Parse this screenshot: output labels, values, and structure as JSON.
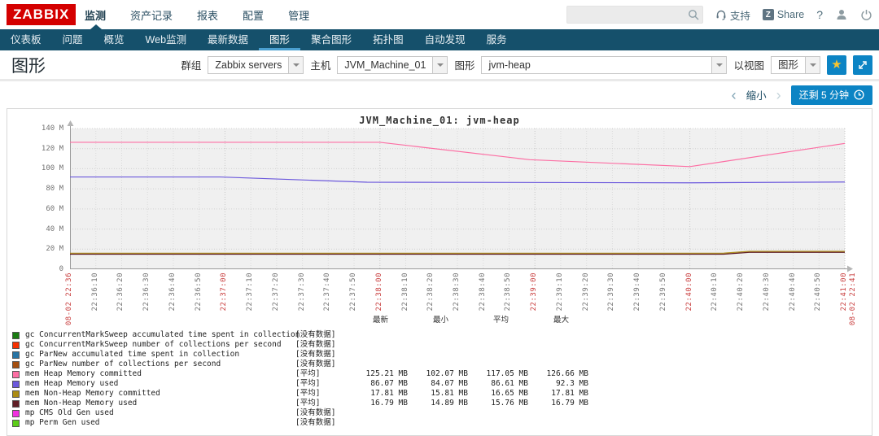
{
  "topbar": {
    "logo": "ZABBIX",
    "menu": [
      "监测",
      "资产记录",
      "报表",
      "配置",
      "管理"
    ],
    "active_menu": "监测",
    "search": {
      "value": "",
      "placeholder": ""
    },
    "support_label": "支持",
    "share_label": "Share",
    "share_icon_letter": "Z",
    "help_label": "?"
  },
  "subnav": {
    "items": [
      "仪表板",
      "问题",
      "概览",
      "Web监测",
      "最新数据",
      "图形",
      "聚合图形",
      "拓扑图",
      "自动发现",
      "服务"
    ],
    "active": "图形"
  },
  "page": {
    "title": "图形"
  },
  "filters": {
    "group_label": "群组",
    "group_value": "Zabbix servers",
    "host_label": "主机",
    "host_value": "JVM_Machine_01",
    "graph_label": "图形",
    "graph_value": "jvm-heap",
    "view_label": "以视图",
    "view_value": "图形"
  },
  "timebar": {
    "prev": "‹",
    "zoom_out": "缩小",
    "next": "›",
    "remaining_label": "还剩 5 分钟"
  },
  "chart_data": {
    "type": "line",
    "title": "JVM_Machine_01: jvm-heap",
    "ylabel_unit": "M",
    "ylim": [
      0,
      140
    ],
    "xlim_seconds": [
      0,
      300
    ],
    "x_start_time": "08-02 22:36",
    "x_end_time": "08-02 22:41",
    "plot_bg": "#f0f0f0",
    "yticks": [
      {
        "v": 0,
        "label": "0"
      },
      {
        "v": 20,
        "label": "20 M"
      },
      {
        "v": 40,
        "label": "40 M"
      },
      {
        "v": 60,
        "label": "60 M"
      },
      {
        "v": 80,
        "label": "80 M"
      },
      {
        "v": 100,
        "label": "100 M"
      },
      {
        "v": 120,
        "label": "120 M"
      },
      {
        "v": 140,
        "label": "140 M"
      }
    ],
    "xticks": [
      {
        "t": 0,
        "label": "08-02 22:36",
        "red": true
      },
      {
        "t": 10,
        "label": "22:36:10"
      },
      {
        "t": 20,
        "label": "22:36:20"
      },
      {
        "t": 30,
        "label": "22:36:30"
      },
      {
        "t": 40,
        "label": "22:36:40"
      },
      {
        "t": 50,
        "label": "22:36:50"
      },
      {
        "t": 60,
        "label": "22:37:00",
        "red": true
      },
      {
        "t": 70,
        "label": "22:37:10"
      },
      {
        "t": 80,
        "label": "22:37:20"
      },
      {
        "t": 90,
        "label": "22:37:30"
      },
      {
        "t": 100,
        "label": "22:37:40"
      },
      {
        "t": 110,
        "label": "22:37:50"
      },
      {
        "t": 120,
        "label": "22:38:00",
        "red": true
      },
      {
        "t": 130,
        "label": "22:38:10"
      },
      {
        "t": 140,
        "label": "22:38:20"
      },
      {
        "t": 150,
        "label": "22:38:30"
      },
      {
        "t": 160,
        "label": "22:38:40"
      },
      {
        "t": 170,
        "label": "22:38:50"
      },
      {
        "t": 180,
        "label": "22:39:00",
        "red": true
      },
      {
        "t": 190,
        "label": "22:39:10"
      },
      {
        "t": 200,
        "label": "22:39:20"
      },
      {
        "t": 210,
        "label": "22:39:30"
      },
      {
        "t": 220,
        "label": "22:39:40"
      },
      {
        "t": 230,
        "label": "22:39:50"
      },
      {
        "t": 240,
        "label": "22:40:00",
        "red": true
      },
      {
        "t": 250,
        "label": "22:40:10"
      },
      {
        "t": 260,
        "label": "22:40:20"
      },
      {
        "t": 270,
        "label": "22:40:30"
      },
      {
        "t": 280,
        "label": "22:40:40"
      },
      {
        "t": 290,
        "label": "22:40:50"
      },
      {
        "t": 300,
        "label": "22:41:00",
        "red": true
      },
      {
        "t": 300,
        "label": "08-02 22:41",
        "red": true,
        "offset": 11
      }
    ],
    "series": [
      {
        "name": "mem Heap Memory committed",
        "color": "#FC6EA3",
        "points": [
          [
            0,
            126.3
          ],
          [
            120,
            126.3
          ],
          [
            178,
            109.0
          ],
          [
            240,
            102.1
          ],
          [
            300,
            125.2
          ]
        ]
      },
      {
        "name": "mem Heap Memory used",
        "color": "#6C59DC",
        "points": [
          [
            0,
            91.8
          ],
          [
            58,
            91.8
          ],
          [
            115,
            86.6
          ],
          [
            240,
            86.0
          ],
          [
            300,
            86.8
          ]
        ]
      },
      {
        "name": "mem Non-Heap Memory committed",
        "color": "#AC8C14",
        "points": [
          [
            0,
            15.95
          ],
          [
            253,
            15.95
          ],
          [
            263,
            17.8
          ],
          [
            300,
            17.8
          ]
        ]
      },
      {
        "name": "mem Non-Heap Memory used",
        "color": "#611F27",
        "points": [
          [
            0,
            14.95
          ],
          [
            253,
            14.95
          ],
          [
            263,
            16.8
          ],
          [
            300,
            16.8
          ]
        ]
      }
    ]
  },
  "legend": {
    "columns": [
      "最新",
      "最小",
      "平均",
      "最大"
    ],
    "rows": [
      {
        "color": "#1A7C11",
        "label": "gc ConcurrentMarkSweep accumulated time spent in collection",
        "func": "[没有数据]",
        "values": [
          "",
          "",
          "",
          ""
        ]
      },
      {
        "color": "#F63100",
        "label": "gc ConcurrentMarkSweep number of collections per second",
        "func": "[没有数据]",
        "values": [
          "",
          "",
          "",
          ""
        ]
      },
      {
        "color": "#2774A4",
        "label": "gc ParNew accumulated time spent in collection",
        "func": "[没有数据]",
        "values": [
          "",
          "",
          "",
          ""
        ]
      },
      {
        "color": "#A54F10",
        "label": "gc ParNew number of collections per second",
        "func": "[没有数据]",
        "values": [
          "",
          "",
          "",
          ""
        ]
      },
      {
        "color": "#FC6EA3",
        "label": "mem Heap Memory committed",
        "func": "[平均]",
        "values": [
          "125.21 MB",
          "102.07 MB",
          "117.05 MB",
          "126.66 MB"
        ]
      },
      {
        "color": "#6C59DC",
        "label": "mem Heap Memory used",
        "func": "[平均]",
        "values": [
          "86.07 MB",
          "84.07 MB",
          "86.61 MB",
          "92.3 MB"
        ]
      },
      {
        "color": "#AC8C14",
        "label": "mem Non-Heap Memory committed",
        "func": "[平均]",
        "values": [
          "17.81 MB",
          "15.81 MB",
          "16.65 MB",
          "17.81 MB"
        ]
      },
      {
        "color": "#611F27",
        "label": "mem Non-Heap Memory used",
        "func": "[平均]",
        "values": [
          "16.79 MB",
          "14.89 MB",
          "15.76 MB",
          "16.79 MB"
        ]
      },
      {
        "color": "#F230E0",
        "label": "mp CMS Old Gen used",
        "func": "[没有数据]",
        "values": [
          "",
          "",
          "",
          ""
        ]
      },
      {
        "color": "#5CCD18",
        "label": "mp Perm Gen used",
        "func": "[没有数据]",
        "values": [
          "",
          "",
          "",
          ""
        ]
      }
    ]
  }
}
